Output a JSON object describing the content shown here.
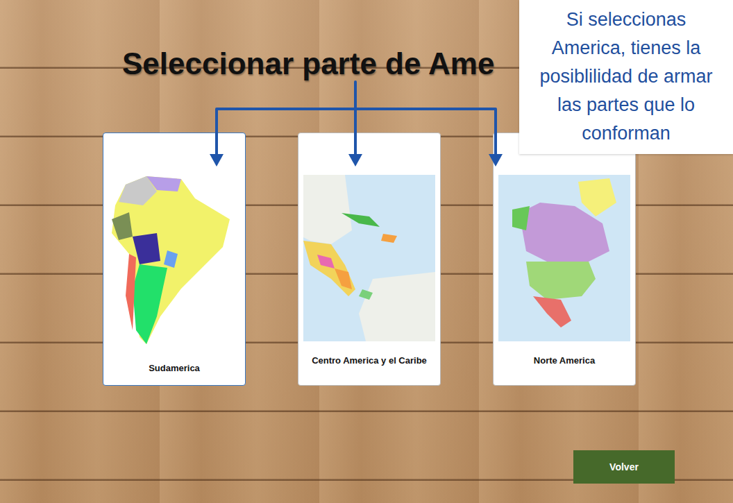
{
  "title": "Seleccionar parte de Ame",
  "callout": {
    "text": "Si seleccionas America, tienes la posiblilidad de armar las partes que lo conforman"
  },
  "cards": [
    {
      "label": "Sudamerica",
      "selected": true,
      "kind": "south"
    },
    {
      "label": "Centro America y el Caribe",
      "selected": false,
      "kind": "central"
    },
    {
      "label": "Norte America",
      "selected": false,
      "kind": "north"
    }
  ],
  "buttons": [
    "Volver"
  ]
}
